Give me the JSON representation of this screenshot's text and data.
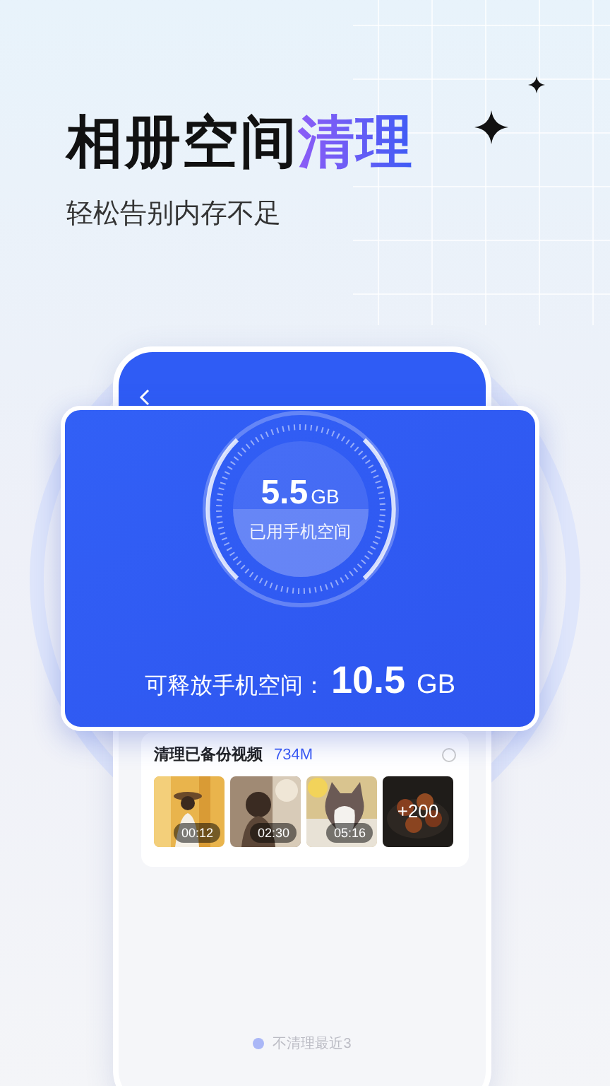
{
  "header": {
    "title_main": "相册空间",
    "title_highlight": "清理",
    "subtitle": "轻松告别内存不足"
  },
  "storage": {
    "used_value": "5.5",
    "used_unit": "GB",
    "used_label": "已用手机空间",
    "free_label": "可释放手机空间：",
    "free_value": "10.5",
    "free_unit": "GB"
  },
  "video_group": {
    "title": "清理已备份视频",
    "size": "734M",
    "selected": false,
    "thumbnails": [
      {
        "kind": "video",
        "duration": "00:12"
      },
      {
        "kind": "video",
        "duration": "02:30"
      },
      {
        "kind": "video",
        "duration": "05:16"
      },
      {
        "kind": "more",
        "count": "+200"
      }
    ]
  },
  "footer_option": {
    "label": "不清理最近3",
    "selected": true
  }
}
